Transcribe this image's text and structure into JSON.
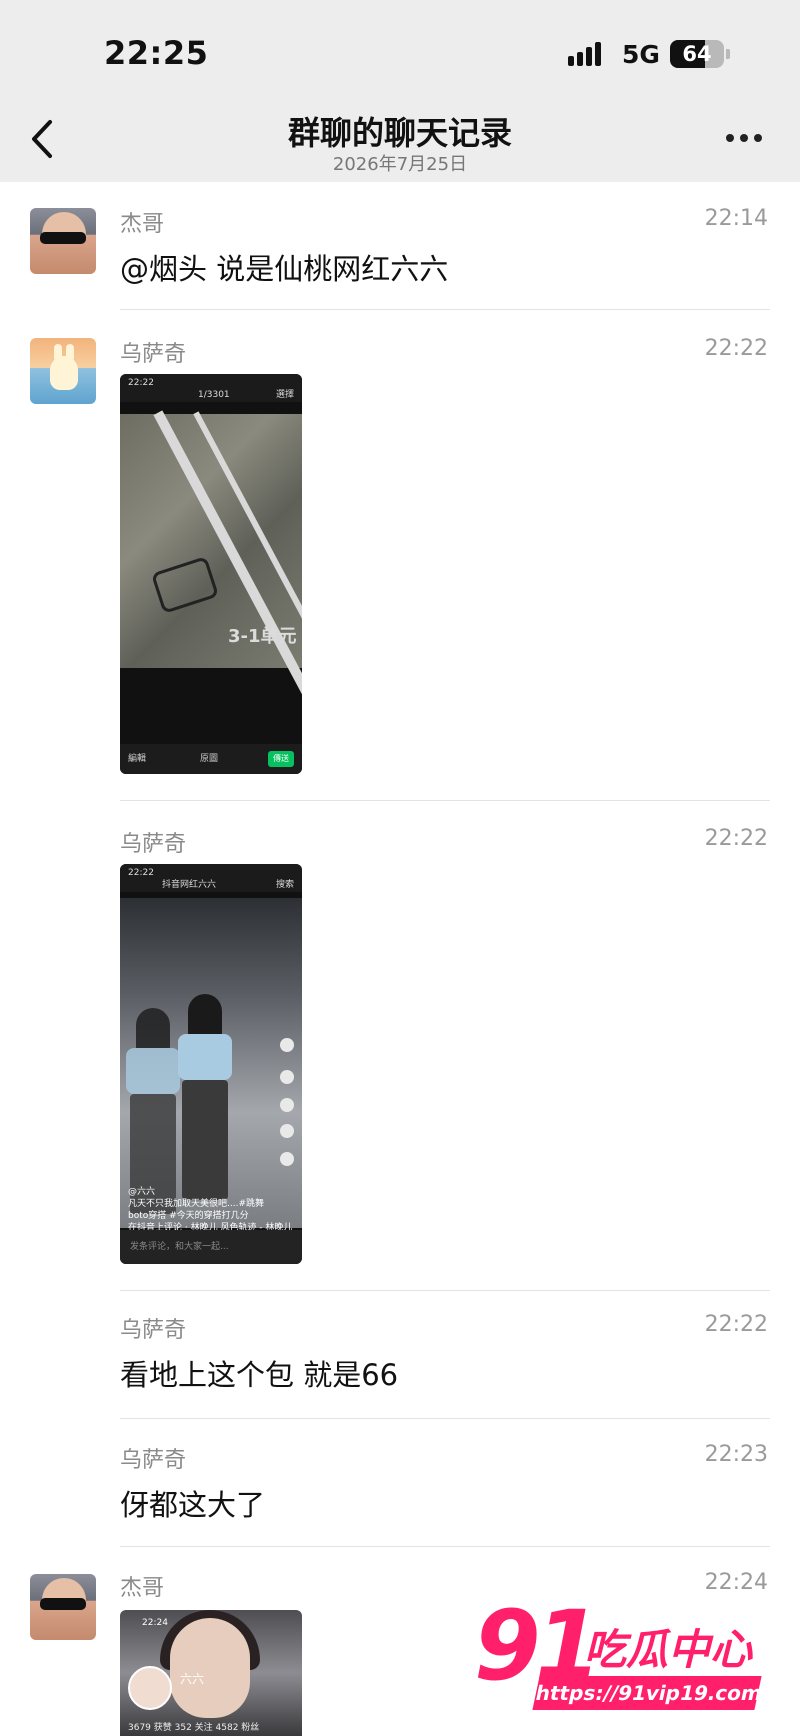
{
  "status_bar": {
    "time": "22:25",
    "network": "5G",
    "battery": "64",
    "battery_level": 0.64
  },
  "nav": {
    "title": "群聊的聊天记录",
    "subtitle": "2026年7月25日",
    "back_icon": "chevron-left-icon",
    "more_icon": "more-dots-icon"
  },
  "messages": [
    {
      "sender": "杰哥",
      "time": "22:14",
      "text": "@烟头 说是仙桃网红六六"
    },
    {
      "sender": "乌萨奇",
      "time": "22:22",
      "image": {
        "status_time": "22:22",
        "counter": "1/3301",
        "select": "選擇",
        "ground_text": "3-1单元",
        "edit": "編輯",
        "original": "原圖",
        "send": "傳送"
      }
    },
    {
      "sender": "乌萨奇",
      "time": "22:22",
      "image": {
        "status_time": "22:22",
        "search": "抖音网红六六",
        "search_btn": "搜索",
        "author": "@六六",
        "caption1": "凡天不只我加取天美很吧....#跳舞",
        "caption2": "boto穿搭 #今天的穿搭打几分",
        "caption3": "在抖音上评论 · 林晚儿  风色轨迹 - 林晚儿",
        "comment_placeholder": "发条评论，和大家一起..."
      }
    },
    {
      "sender": "乌萨奇",
      "time": "22:22",
      "text": "看地上这个包 就是66"
    },
    {
      "sender": "乌萨奇",
      "time": "22:23",
      "text": "伢都这大了"
    },
    {
      "sender": "杰哥",
      "time": "22:24",
      "image": {
        "status_time": "22:24",
        "name": "六六",
        "stats": "3679 获赞  352 关注  4582 粉丝"
      }
    }
  ],
  "watermark": {
    "brand": "91",
    "brand_cn": "吃瓜中心",
    "url": "https://91vip19.com"
  }
}
